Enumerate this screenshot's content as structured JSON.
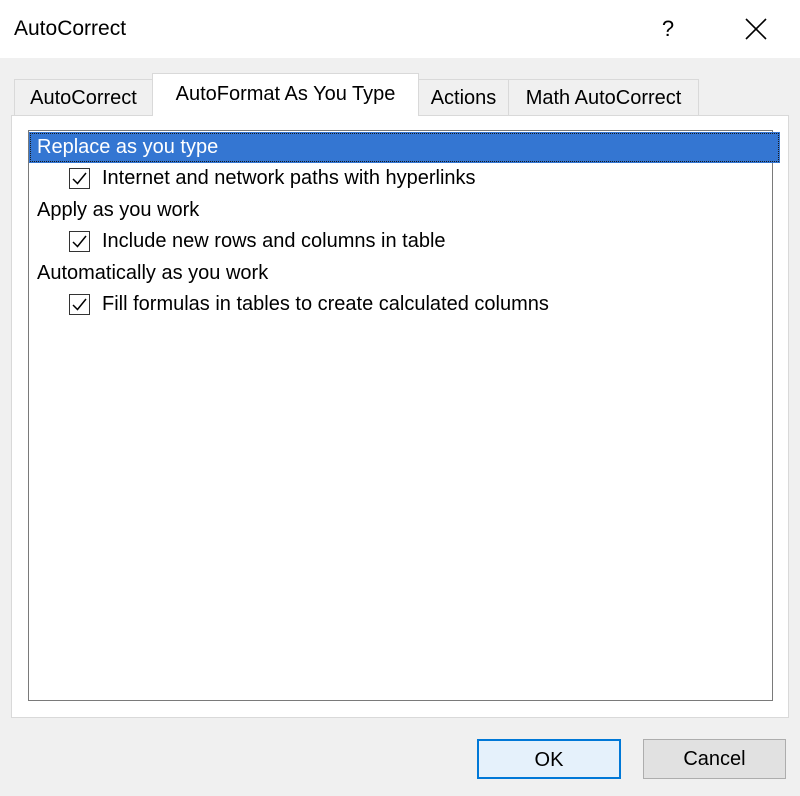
{
  "window": {
    "title": "AutoCorrect",
    "help_label": "?",
    "close_icon": "close-icon"
  },
  "tabs": [
    {
      "label": "AutoCorrect",
      "active": false
    },
    {
      "label": "AutoFormat As You Type",
      "active": true
    },
    {
      "label": "Actions",
      "active": false
    },
    {
      "label": "Math AutoCorrect",
      "active": false
    }
  ],
  "list": {
    "groups": [
      {
        "label": "Replace as you type",
        "selected": true,
        "items": [
          {
            "label": "Internet and network paths with hyperlinks",
            "checked": true
          }
        ]
      },
      {
        "label": "Apply as you work",
        "selected": false,
        "items": [
          {
            "label": "Include new rows and columns in table",
            "checked": true
          }
        ]
      },
      {
        "label": "Automatically as you work",
        "selected": false,
        "items": [
          {
            "label": "Fill formulas in tables to create calculated columns",
            "checked": true
          }
        ]
      }
    ]
  },
  "buttons": {
    "ok_label": "OK",
    "cancel_label": "Cancel"
  },
  "colors": {
    "selection": "#3476d2",
    "default_button_border": "#0078d7"
  }
}
